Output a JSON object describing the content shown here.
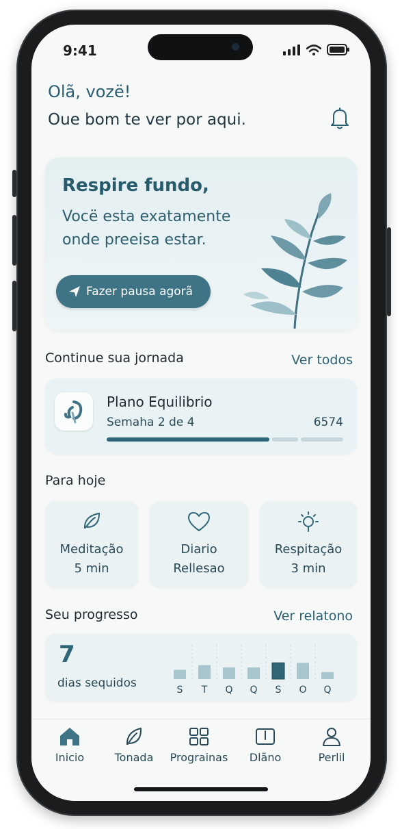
{
  "status": {
    "time": "9:41"
  },
  "header": {
    "greeting": "Olã, vozë!",
    "subtitle": "Oue bom te ver por aqui."
  },
  "hero": {
    "title": "Respire fundo,",
    "line1": "Vocë esta exatamente",
    "line2": "onde preeisa estar.",
    "button_label": "Fazer pausa agorã"
  },
  "journey": {
    "section_title": "Continue sua jornada",
    "see_all": "Ver todos",
    "plan_title": "Plano Equilibrio",
    "plan_week": "Semaha 2 de 4",
    "plan_number": "6574",
    "progress_segments_filled": 1,
    "progress_segments_total": 3
  },
  "today": {
    "section_title": "Para hoje",
    "items": [
      {
        "icon": "leaf-icon",
        "line1": "Meditação",
        "line2": "5 min"
      },
      {
        "icon": "heart-icon",
        "line1": "Diario",
        "line2": "Rellesao"
      },
      {
        "icon": "sun-icon",
        "line1": "Respitação",
        "line2": "3 min"
      }
    ]
  },
  "progress": {
    "section_title": "Seu progresso",
    "report_link": "Ver relatono",
    "streak": "7",
    "streak_label": "dias sequidos",
    "day_labels": [
      "S",
      "T",
      "Q",
      "Q",
      "S",
      "O",
      "Q"
    ],
    "day_values": [
      0.4,
      0.6,
      0.5,
      0.5,
      0.7,
      0.7,
      0.3
    ],
    "highlight_index": 4
  },
  "tabs": [
    {
      "label": "Inicio",
      "icon": "home-icon",
      "active": true
    },
    {
      "label": "Tonada",
      "icon": "leaf-icon"
    },
    {
      "label": "Prograinas",
      "icon": "grid-icon"
    },
    {
      "label": "Dlãno",
      "icon": "book-icon"
    },
    {
      "label": "Perlil",
      "icon": "user-icon"
    }
  ],
  "colors": {
    "accent": "#2f6678",
    "background": "#f7f9f9",
    "card": "#eaf2f4"
  }
}
